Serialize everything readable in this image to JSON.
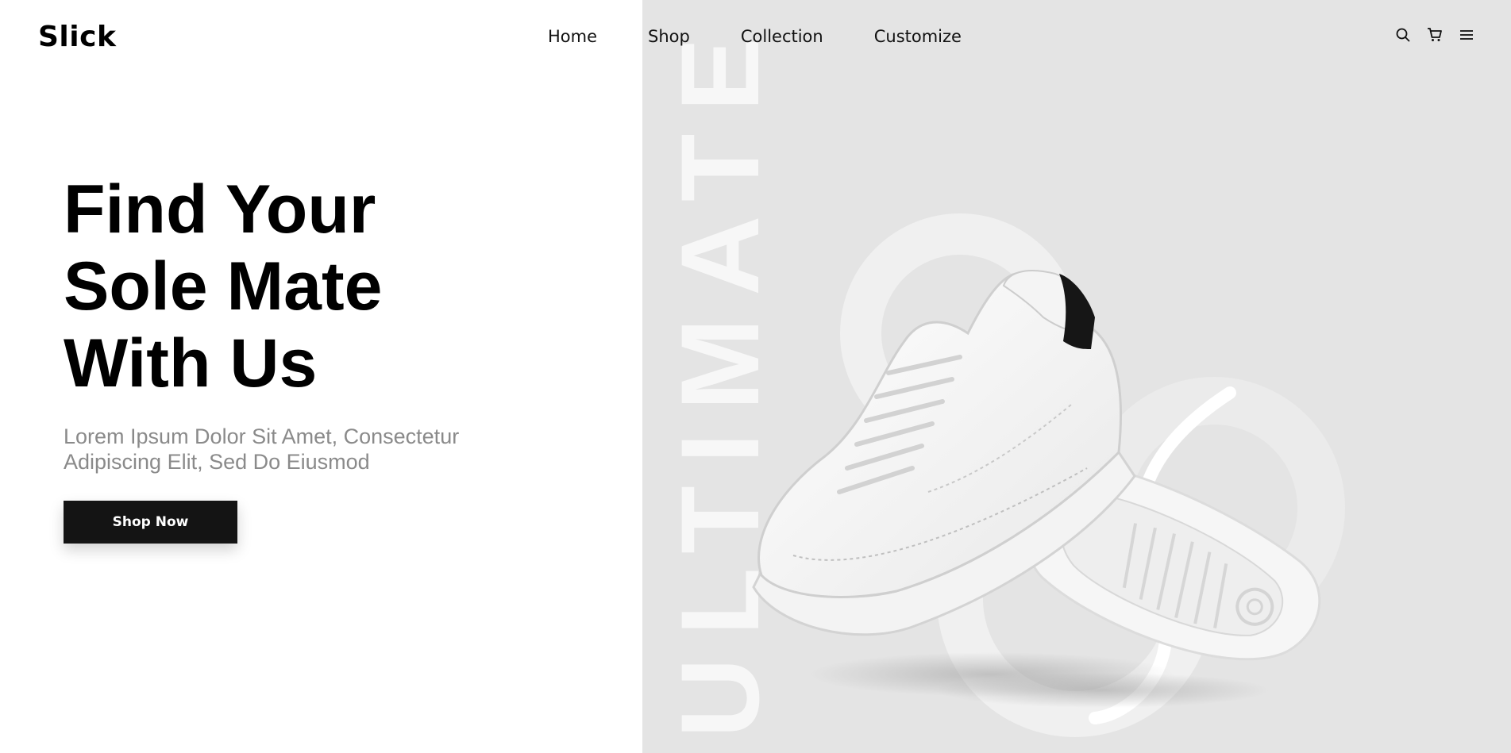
{
  "brand": {
    "name": "Slick"
  },
  "nav": {
    "items": [
      "Home",
      "Shop",
      "Collection",
      "Customize"
    ]
  },
  "header_icons": [
    "search-icon",
    "cart-icon",
    "menu-icon"
  ],
  "hero": {
    "title_lines": [
      "Find Your",
      "Sole Mate",
      "With Us"
    ],
    "subtitle": "Lorem Ipsum Dolor Sit Amet, Consectetur Adipiscing Elit, Sed Do Eiusmod",
    "cta_label": "Shop Now",
    "watermark": "ULTIMATE"
  },
  "colors": {
    "left_background": "#ffffff",
    "right_background": "#e4e4e4",
    "cta_background": "#141414",
    "subtitle_text": "#8a8a8a"
  }
}
